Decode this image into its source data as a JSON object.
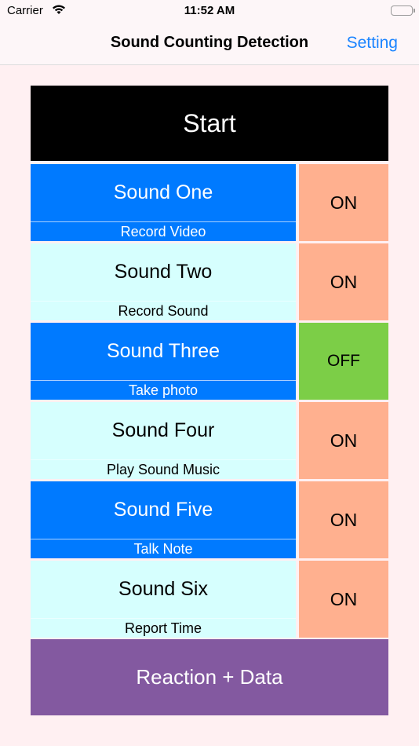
{
  "status_bar": {
    "carrier": "Carrier",
    "time": "11:52 AM",
    "wifi_icon": "wifi-icon",
    "battery_icon": "battery-full-icon"
  },
  "nav": {
    "title": "Sound Counting Detection",
    "setting_label": "Setting"
  },
  "start_label": "Start",
  "sounds": [
    {
      "name": "Sound One",
      "action": "Record Video",
      "state": "ON",
      "style": "blue"
    },
    {
      "name": "Sound Two",
      "action": "Record Sound",
      "state": "ON",
      "style": "cyan"
    },
    {
      "name": "Sound Three",
      "action": "Take photo",
      "state": "OFF",
      "style": "blue"
    },
    {
      "name": "Sound Four",
      "action": "Play Sound Music",
      "state": "ON",
      "style": "cyan"
    },
    {
      "name": "Sound Five",
      "action": "Talk Note",
      "state": "ON",
      "style": "blue"
    },
    {
      "name": "Sound Six",
      "action": "Report Time",
      "state": "ON",
      "style": "cyan"
    }
  ],
  "reaction_label": "Reaction + Data",
  "colors": {
    "accent_blue": "#007aff",
    "cyan_row": "#d6fffe",
    "on_toggle": "#ffb08f",
    "off_toggle": "#7cce47",
    "reaction_button": "#8359a0",
    "start_button": "#000000",
    "background": "#fff0f2"
  }
}
